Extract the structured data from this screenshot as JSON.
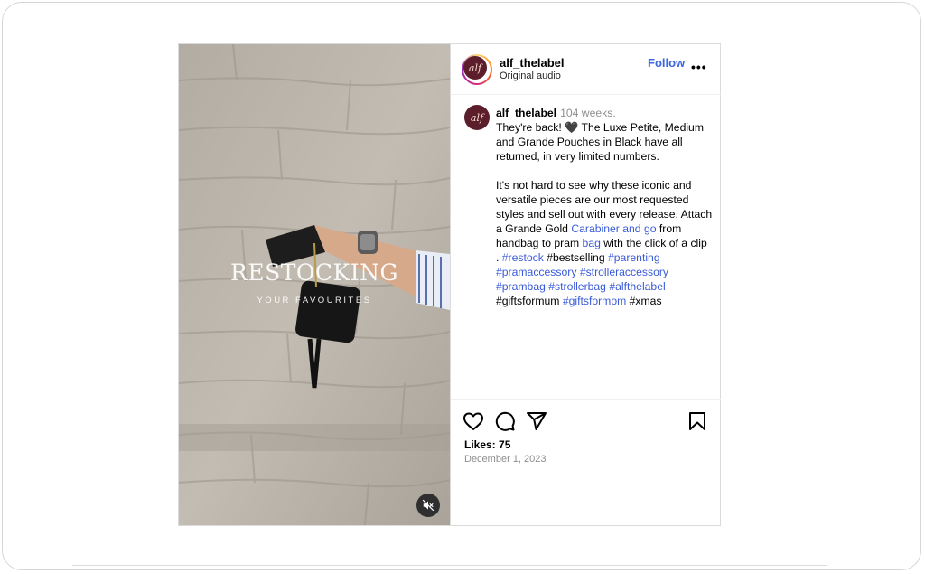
{
  "post": {
    "overlay": {
      "title": "RESTOCKING",
      "subtitle": "YOUR FAVOURITES"
    },
    "header": {
      "avatar_text": "alf",
      "username": "alf_thelabel",
      "audio": "Original audio",
      "follow_label": "Follow",
      "more_label": "•••"
    },
    "caption": {
      "avatar_text": "alf",
      "username": "alf_thelabel",
      "time": "104 weeks.",
      "line1": "They're back! 🖤  The Luxe Petite, Medium and Grande Pouches in Black have all returned, in very limited numbers.",
      "line2_a": "It's not hard to see why these iconic and versatile pieces are our most requested styles and sell out with every release. Attach a Grande Gold ",
      "link_carabiner": "Carabiner and go",
      "line2_b": " from handbag to pram ",
      "link_bag": "bag",
      "line2_c": " with the click of a clip",
      "line3_prefix": ". ",
      "tags": {
        "restock": "#restock",
        "bestselling": "#bestselling",
        "parenting": "#parenting",
        "pramaccessory": "#pramaccessory",
        "strolleraccessory": "#strolleraccessory",
        "prambag": "#prambag",
        "strollerbag": "#strollerbag",
        "alfthelabel": "#alfthelabel",
        "giftsforum": "#giftsformum",
        "giftsformom": "#giftsformom",
        "xmas": "#xmas"
      }
    },
    "actions": {
      "icons": [
        "heart-icon",
        "comment-icon",
        "share-icon",
        "bookmark-icon"
      ]
    },
    "likes": "Likes: 75",
    "date": "December 1, 2023"
  },
  "colors": {
    "link": "#3a5bd9",
    "follow": "#3a66e0",
    "avatar_bg": "#5b1e2a",
    "muted_text": "#8e8e8e"
  }
}
